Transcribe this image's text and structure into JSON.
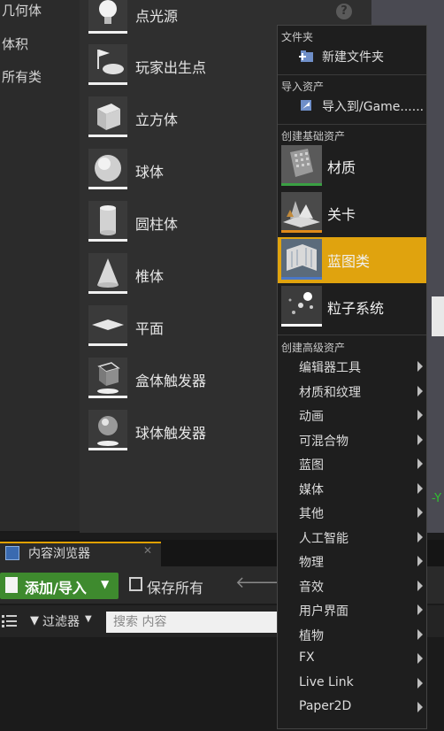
{
  "left_categories": [
    "几何体",
    "体积",
    "所有类"
  ],
  "place_items": [
    {
      "label": "点光源",
      "icon": "bulb-icon"
    },
    {
      "label": "玩家出生点",
      "icon": "player-start-icon"
    },
    {
      "label": "立方体",
      "icon": "cube-icon"
    },
    {
      "label": "球体",
      "icon": "sphere-icon"
    },
    {
      "label": "圆柱体",
      "icon": "cylinder-icon"
    },
    {
      "label": "椎体",
      "icon": "cone-icon"
    },
    {
      "label": "平面",
      "icon": "plane-icon"
    },
    {
      "label": "盒体触发器",
      "icon": "box-trigger-icon"
    },
    {
      "label": "球体触发器",
      "icon": "sphere-trigger-icon"
    }
  ],
  "help_icon_glyph": "?",
  "viewport_axis_label": "-Y",
  "content_browser": {
    "tab_label": "内容浏览器",
    "tab_close": "✕",
    "add_import_label": "添加/导入",
    "save_all_label": "保存所有",
    "nav_back": "🡐",
    "nav_forward": "🡒",
    "filter_label": "过滤器",
    "search_placeholder": "搜索 内容"
  },
  "menu": {
    "folder_section": "文件夹",
    "new_folder_label": "新建文件夹",
    "import_section": "导入资产",
    "import_to_label": "导入到/Game......",
    "basic_section": "创建基础资产",
    "basic_items": [
      {
        "label": "材质",
        "icon": "material-icon",
        "accent": "#3aa043"
      },
      {
        "label": "关卡",
        "icon": "level-icon",
        "accent": "#e08a1a"
      },
      {
        "label": "蓝图类",
        "icon": "blueprint-icon",
        "accent": "#4a78c8",
        "highlighted": true
      },
      {
        "label": "粒子系统",
        "icon": "particle-icon",
        "accent": "#ffffff"
      }
    ],
    "advanced_section": "创建高级资产",
    "advanced_items": [
      "编辑器工具",
      "材质和纹理",
      "动画",
      "可混合物",
      "蓝图",
      "媒体",
      "其他",
      "人工智能",
      "物理",
      "音效",
      "用户界面",
      "植物",
      "FX",
      "Live Link",
      "Paper2D"
    ]
  },
  "colors": {
    "highlight": "#e0a30e",
    "add_button": "#3e8a2e",
    "axis_green": "#30c030"
  }
}
